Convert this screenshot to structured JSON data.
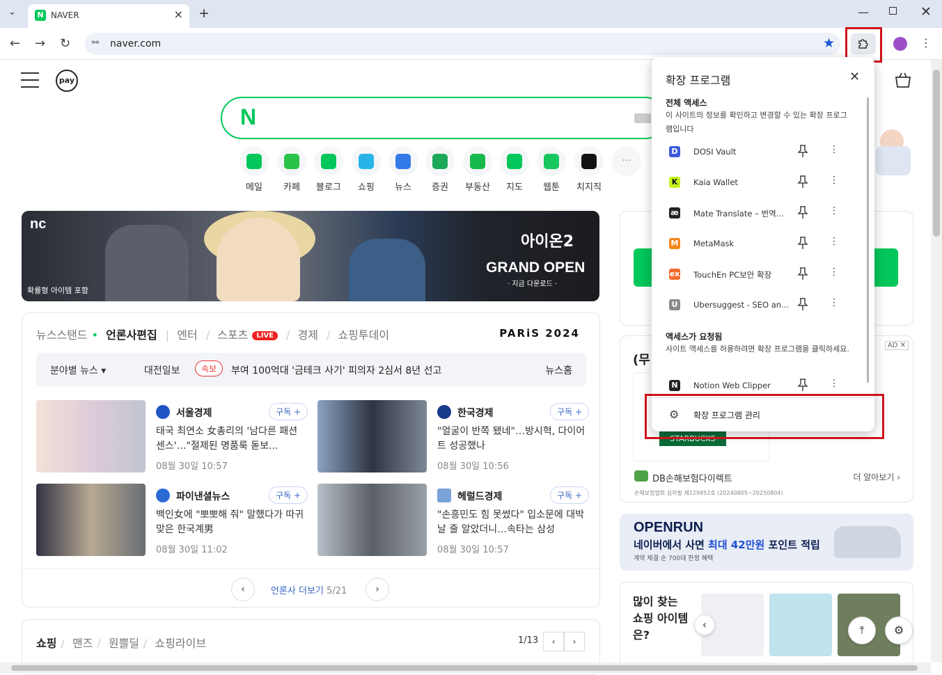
{
  "browser": {
    "tab_title": "NAVER",
    "tab_favicon": "N",
    "url": "naver.com",
    "accent": "#1a58d6"
  },
  "naver": {
    "pay_label": "pay",
    "logo": "N",
    "brand_color": "#03c75a",
    "services": [
      {
        "label": "메일",
        "color": "#03c75a"
      },
      {
        "label": "카페",
        "color": "#2ac34a"
      },
      {
        "label": "블로그",
        "color": "#03c75a"
      },
      {
        "label": "쇼핑",
        "color": "#28b4e6"
      },
      {
        "label": "뉴스",
        "color": "#3479e8"
      },
      {
        "label": "증권",
        "color": "#1ea85a"
      },
      {
        "label": "부동산",
        "color": "#19b84c"
      },
      {
        "label": "지도",
        "color": "#03c75a"
      },
      {
        "label": "웹툰",
        "color": "#17c75e"
      },
      {
        "label": "치지직",
        "color": "#111111"
      }
    ],
    "more_label": "···"
  },
  "banner": {
    "brand": "nc",
    "caption": "확률형 아이템 포함",
    "logo_text": "아이온2",
    "headline": "GRAND OPEN",
    "sub": "· 지금 다운로드 ·"
  },
  "news": {
    "tabs": [
      "뉴스스탠드",
      "언론사편집",
      "엔터",
      "스포츠",
      "경제",
      "쇼핑투데이"
    ],
    "live_badge": "LIVE",
    "paris": "PARiS 2024",
    "ticker": {
      "category": "분야별 뉴스 ▾",
      "press": "대전일보",
      "badge": "속보",
      "headline": "부여 100억대 '금테크 사기' 피의자 2심서 8년 선고",
      "home": "뉴스홈"
    },
    "subscribe_label": "구독 +",
    "cards": [
      {
        "press": "서울경제",
        "headline": "태국 최연소 女총리의 '남다른 패션 센스'…\"절제된 명품룩 돋보...",
        "time": "08월 30일 10:57"
      },
      {
        "press": "한국경제",
        "headline": "\"얼굴이 반쪽 됐네\"…방시혁, 다이어트 성공했나",
        "time": "08월 30일 10:56"
      },
      {
        "press": "파이낸셜뉴스",
        "headline": "백인女에 \"뽀뽀해 줘\" 말했다가 따귀 맞은 한국계男",
        "time": "08월 30일 11:02"
      },
      {
        "press": "헤럴드경제",
        "headline": "\"손흥민도 힘 못썼다\" 입소문에 대박날 줄 알았더니…속타는 삼성",
        "time": "08월 30일 10:57"
      }
    ],
    "more_label": "언론사 더보기",
    "page": "5/21"
  },
  "shopping": {
    "tabs": [
      "쇼핑",
      "맨즈",
      "원쁠딜",
      "쇼핑라이브"
    ],
    "page": "1/13"
  },
  "ad": {
    "label": "AD ✕",
    "title_start": "(무",
    "starbucks": "STARBUCKS",
    "brand": "DB손해보험다이렉트",
    "more": "더 알아보기 ›",
    "fine": "손해보험협회 심의필 제129852호 (20240805~20250804)"
  },
  "openrun": {
    "title": "OPENRUN",
    "line_prefix": "네이버에서 사면 ",
    "line_highlight": "최대 42만원",
    "line_suffix": " 포인트 적립",
    "fine": "계약 체결 순 700대 한정 혜택"
  },
  "shop2": {
    "question": "많이 찾는 쇼핑 아이템은?"
  },
  "extensions": {
    "title": "확장 프로그램",
    "full_access_title": "전체 액세스",
    "full_access_desc": "이 사이트의 정보를 확인하고 변경할 수 있는 확장 프로그램입니다",
    "items": [
      {
        "name": "DOSI Vault",
        "icon": "dosi-icon",
        "color": "#3d5ad8",
        "glyph": "D"
      },
      {
        "name": "Kaia Wallet",
        "icon": "kaia-icon",
        "color": "#c6f41e",
        "glyph": "K"
      },
      {
        "name": "Mate Translate – 번역...",
        "icon": "mate-icon",
        "color": "#222222",
        "glyph": "æ"
      },
      {
        "name": "MetaMask",
        "icon": "metamask-icon",
        "color": "#f6851b",
        "glyph": "M"
      },
      {
        "name": "TouchEn PC보안 확장",
        "icon": "touchen-icon",
        "color": "#f26b2b",
        "glyph": "ex"
      },
      {
        "name": "Ubersuggest - SEO an...",
        "icon": "ubersuggest-icon",
        "color": "#8a8a8a",
        "glyph": "U"
      }
    ],
    "requested_title": "액세스가 요청됨",
    "requested_desc": "사이트 액세스를 허용하려면 확장 프로그램을 클릭하세요.",
    "requested_items": [
      {
        "name": "Notion Web Clipper",
        "icon": "notion-icon",
        "color": "#222222",
        "glyph": "N"
      }
    ],
    "manage_label": "확장 프로그램 관리",
    "highlight_color": "#d0121a"
  }
}
